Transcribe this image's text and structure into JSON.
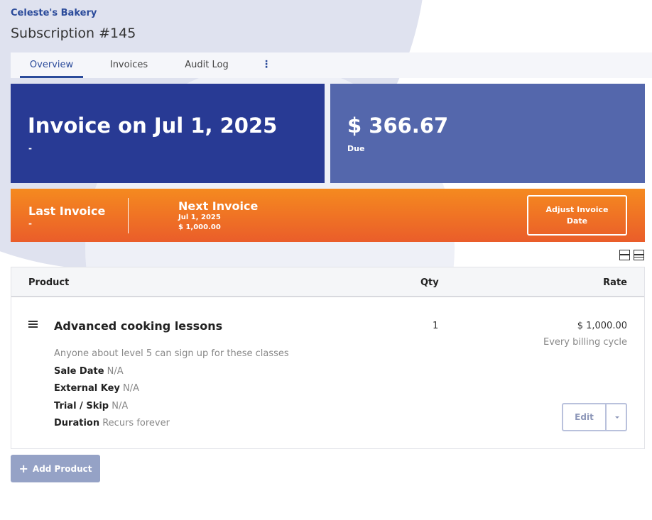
{
  "header": {
    "company": "Celeste's Bakery",
    "title": "Subscription #145"
  },
  "tabs": [
    {
      "label": "Overview",
      "active": true
    },
    {
      "label": "Invoices",
      "active": false
    },
    {
      "label": "Audit Log",
      "active": false
    }
  ],
  "tabs_more_icon": "vertical-ellipsis",
  "summary": {
    "invoice_title": "Invoice on Jul 1, 2025",
    "invoice_sub": "-",
    "amount": "$ 366.67",
    "amount_label": "Due"
  },
  "invoice_bar": {
    "last_label": "Last Invoice",
    "last_value": "-",
    "next_label": "Next Invoice",
    "next_date": "Jul 1, 2025",
    "next_amount": "$ 1,000.00",
    "adjust_button": "Adjust Invoice Date"
  },
  "table": {
    "headers": {
      "product": "Product",
      "qty": "Qty",
      "rate": "Rate"
    },
    "rows": [
      {
        "title": "Advanced cooking lessons",
        "qty": "1",
        "rate": "$ 1,000.00",
        "cycle": "Every billing cycle",
        "description": "Anyone about level 5 can sign up for these classes",
        "meta": [
          {
            "label": "Sale Date",
            "value": "N/A"
          },
          {
            "label": "External Key",
            "value": "N/A"
          },
          {
            "label": "Trial / Skip",
            "value": "N/A"
          },
          {
            "label": "Duration",
            "value": "Recurs forever"
          }
        ],
        "edit_label": "Edit"
      }
    ]
  },
  "add_product_label": "Add Product",
  "colors": {
    "brand_blue": "#2a4a9a",
    "invoice_card": "#283a94",
    "due_card": "#5467ac",
    "orange_top": "#f58a1f",
    "orange_bottom": "#ea5d2a",
    "add_button": "#95a2c6"
  }
}
